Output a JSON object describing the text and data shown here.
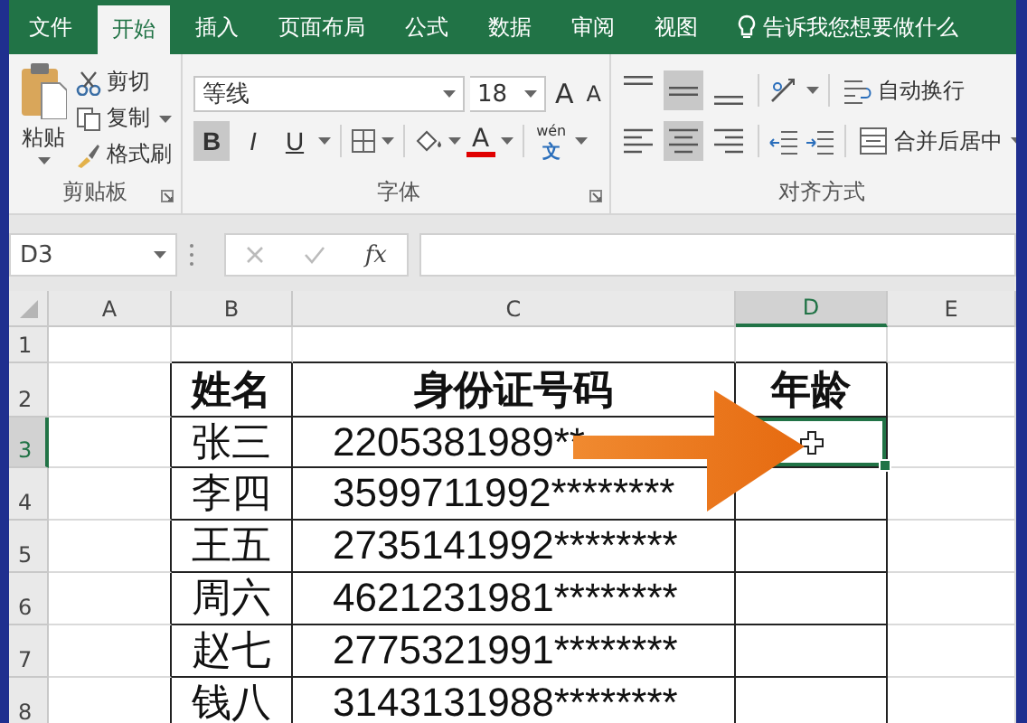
{
  "tabs": [
    {
      "label": "文件",
      "selected": false
    },
    {
      "label": "开始",
      "selected": true
    },
    {
      "label": "插入",
      "selected": false
    },
    {
      "label": "页面布局",
      "selected": false
    },
    {
      "label": "公式",
      "selected": false
    },
    {
      "label": "数据",
      "selected": false
    },
    {
      "label": "审阅",
      "selected": false
    },
    {
      "label": "视图",
      "selected": false
    }
  ],
  "tell_me": "告诉我您想要做什么",
  "clipboard": {
    "paste": "粘贴",
    "cut": "剪切",
    "copy": "复制",
    "format_painter": "格式刷",
    "group": "剪贴板"
  },
  "font": {
    "name": "等线",
    "size": "18",
    "grow": "A",
    "shrink": "A",
    "bold": {
      "label": "B",
      "selected": true
    },
    "italic": {
      "label": "I",
      "selected": false
    },
    "underline": {
      "label": "U",
      "selected": false
    },
    "font_color": "A",
    "phonetic_top": "wén",
    "phonetic_bottom": "文",
    "group": "字体"
  },
  "alignment": {
    "vertical": [
      {
        "kind": "top",
        "selected": false
      },
      {
        "kind": "middle",
        "selected": true
      },
      {
        "kind": "bottom",
        "selected": false
      }
    ],
    "horizontal": [
      {
        "kind": "left",
        "selected": false
      },
      {
        "kind": "center",
        "selected": true
      },
      {
        "kind": "right",
        "selected": false
      }
    ],
    "wrap_text": "自动换行",
    "merge_center": "合并后居中",
    "group": "对齐方式"
  },
  "formula_bar": {
    "name_box": "D3",
    "function_label": "fx"
  },
  "sheet": {
    "columns": [
      {
        "label": "A",
        "selected": false
      },
      {
        "label": "B",
        "selected": false
      },
      {
        "label": "C",
        "selected": false
      },
      {
        "label": "D",
        "selected": true
      },
      {
        "label": "E",
        "selected": false
      }
    ],
    "row_numbers": [
      {
        "label": "1",
        "selected": false
      },
      {
        "label": "2",
        "selected": false
      },
      {
        "label": "3",
        "selected": true
      },
      {
        "label": "4",
        "selected": false
      },
      {
        "label": "5",
        "selected": false
      },
      {
        "label": "6",
        "selected": false
      },
      {
        "label": "7",
        "selected": false
      },
      {
        "label": "8",
        "selected": false
      }
    ],
    "header": [
      "姓名",
      "身份证号码",
      "年龄"
    ],
    "rows": [
      {
        "name": "张三",
        "id_number": "2205381989**",
        "age_selected": true
      },
      {
        "name": "李四",
        "id_number": "3599711992********",
        "age_selected": false
      },
      {
        "name": "王五",
        "id_number": "2735141992********",
        "age_selected": false
      },
      {
        "name": "周六",
        "id_number": "4621231981********",
        "age_selected": false
      },
      {
        "name": "赵七",
        "id_number": "2775321991********",
        "age_selected": false
      },
      {
        "name": "钱八",
        "id_number": "3143131988********",
        "age_selected": false
      }
    ]
  }
}
